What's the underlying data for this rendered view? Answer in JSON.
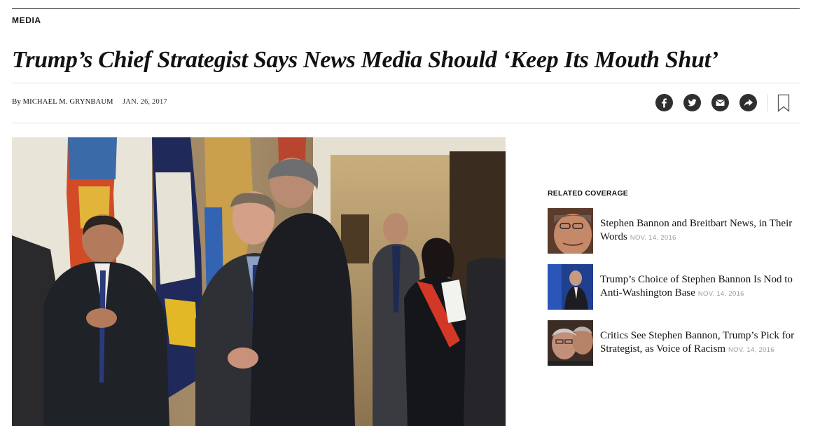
{
  "section": "MEDIA",
  "headline": "Trump’s Chief Strategist Says News Media Should ‘Keep Its Mouth Shut’",
  "byline": {
    "by": "By",
    "author": "MICHAEL M. GRYNBAUM",
    "date": "JAN. 26, 2017"
  },
  "share_icons": [
    "facebook-icon",
    "twitter-icon",
    "email-icon",
    "share-icon",
    "bookmark-icon"
  ],
  "colors": {
    "text": "#121212",
    "rule": "#e2e2e2",
    "icon_bg": "#2f2f2f",
    "date_gray": "#999999"
  },
  "related": {
    "title": "RELATED COVERAGE",
    "items": [
      {
        "title": "Stephen Bannon and Breitbart News, in Their Words",
        "date": "NOV. 14, 2016"
      },
      {
        "title": "Trump’s Choice of Stephen Bannon Is Nod to Anti-Washington Base",
        "date": "NOV. 14, 2016"
      },
      {
        "title": "Critics See Stephen Bannon, Trump’s Pick for Strategist, as Voice of Racism",
        "date": "NOV. 14, 2016"
      }
    ]
  }
}
